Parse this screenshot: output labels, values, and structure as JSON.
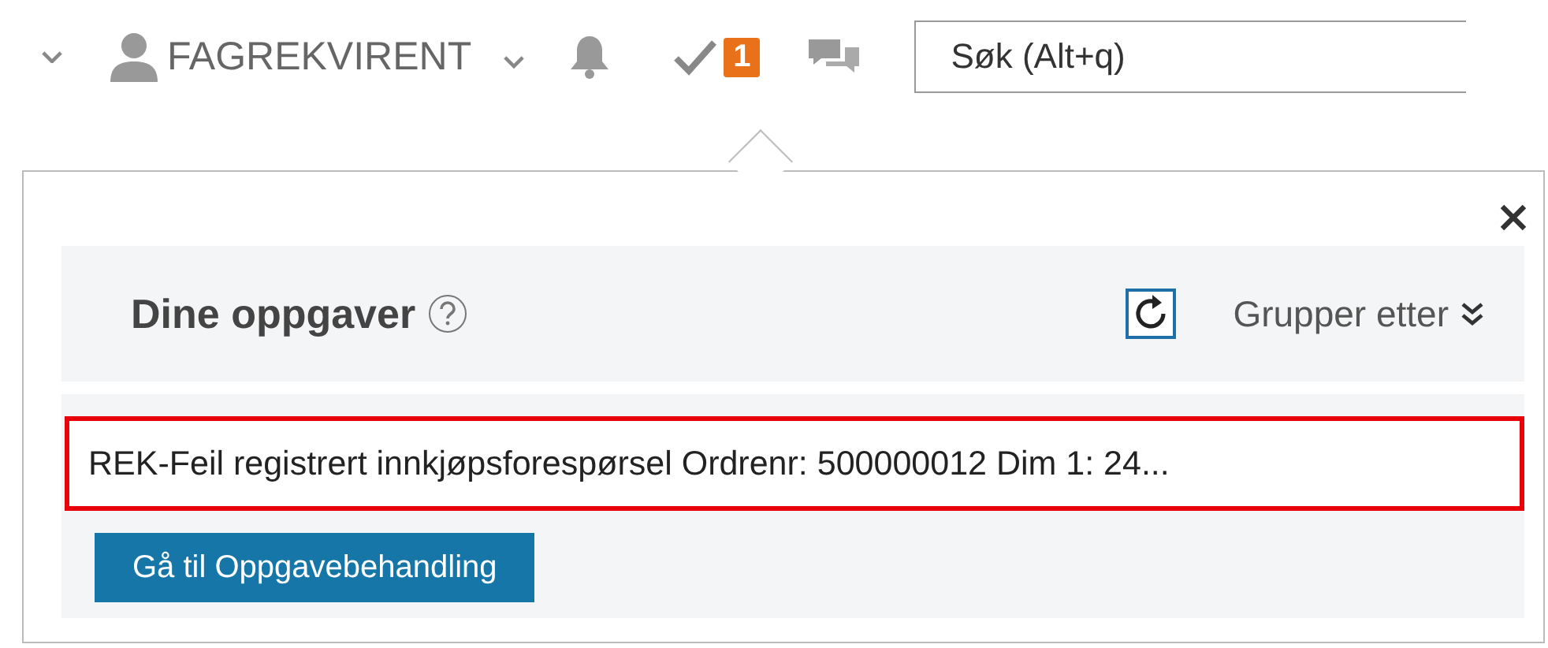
{
  "topbar": {
    "user": "FAGREKVIRENT",
    "task_count": "1",
    "search": {
      "placeholder": "Søk (Alt+q)"
    }
  },
  "popover": {
    "title": "Dine oppgaver",
    "group_by": "Grupper etter",
    "tasks": [
      {
        "text": "REK-Feil registrert innkjøpsforespørsel Ordrenr: 500000012 Dim 1: 24...",
        "selected": true
      }
    ],
    "button": "Gå til Oppgavebehandling"
  }
}
